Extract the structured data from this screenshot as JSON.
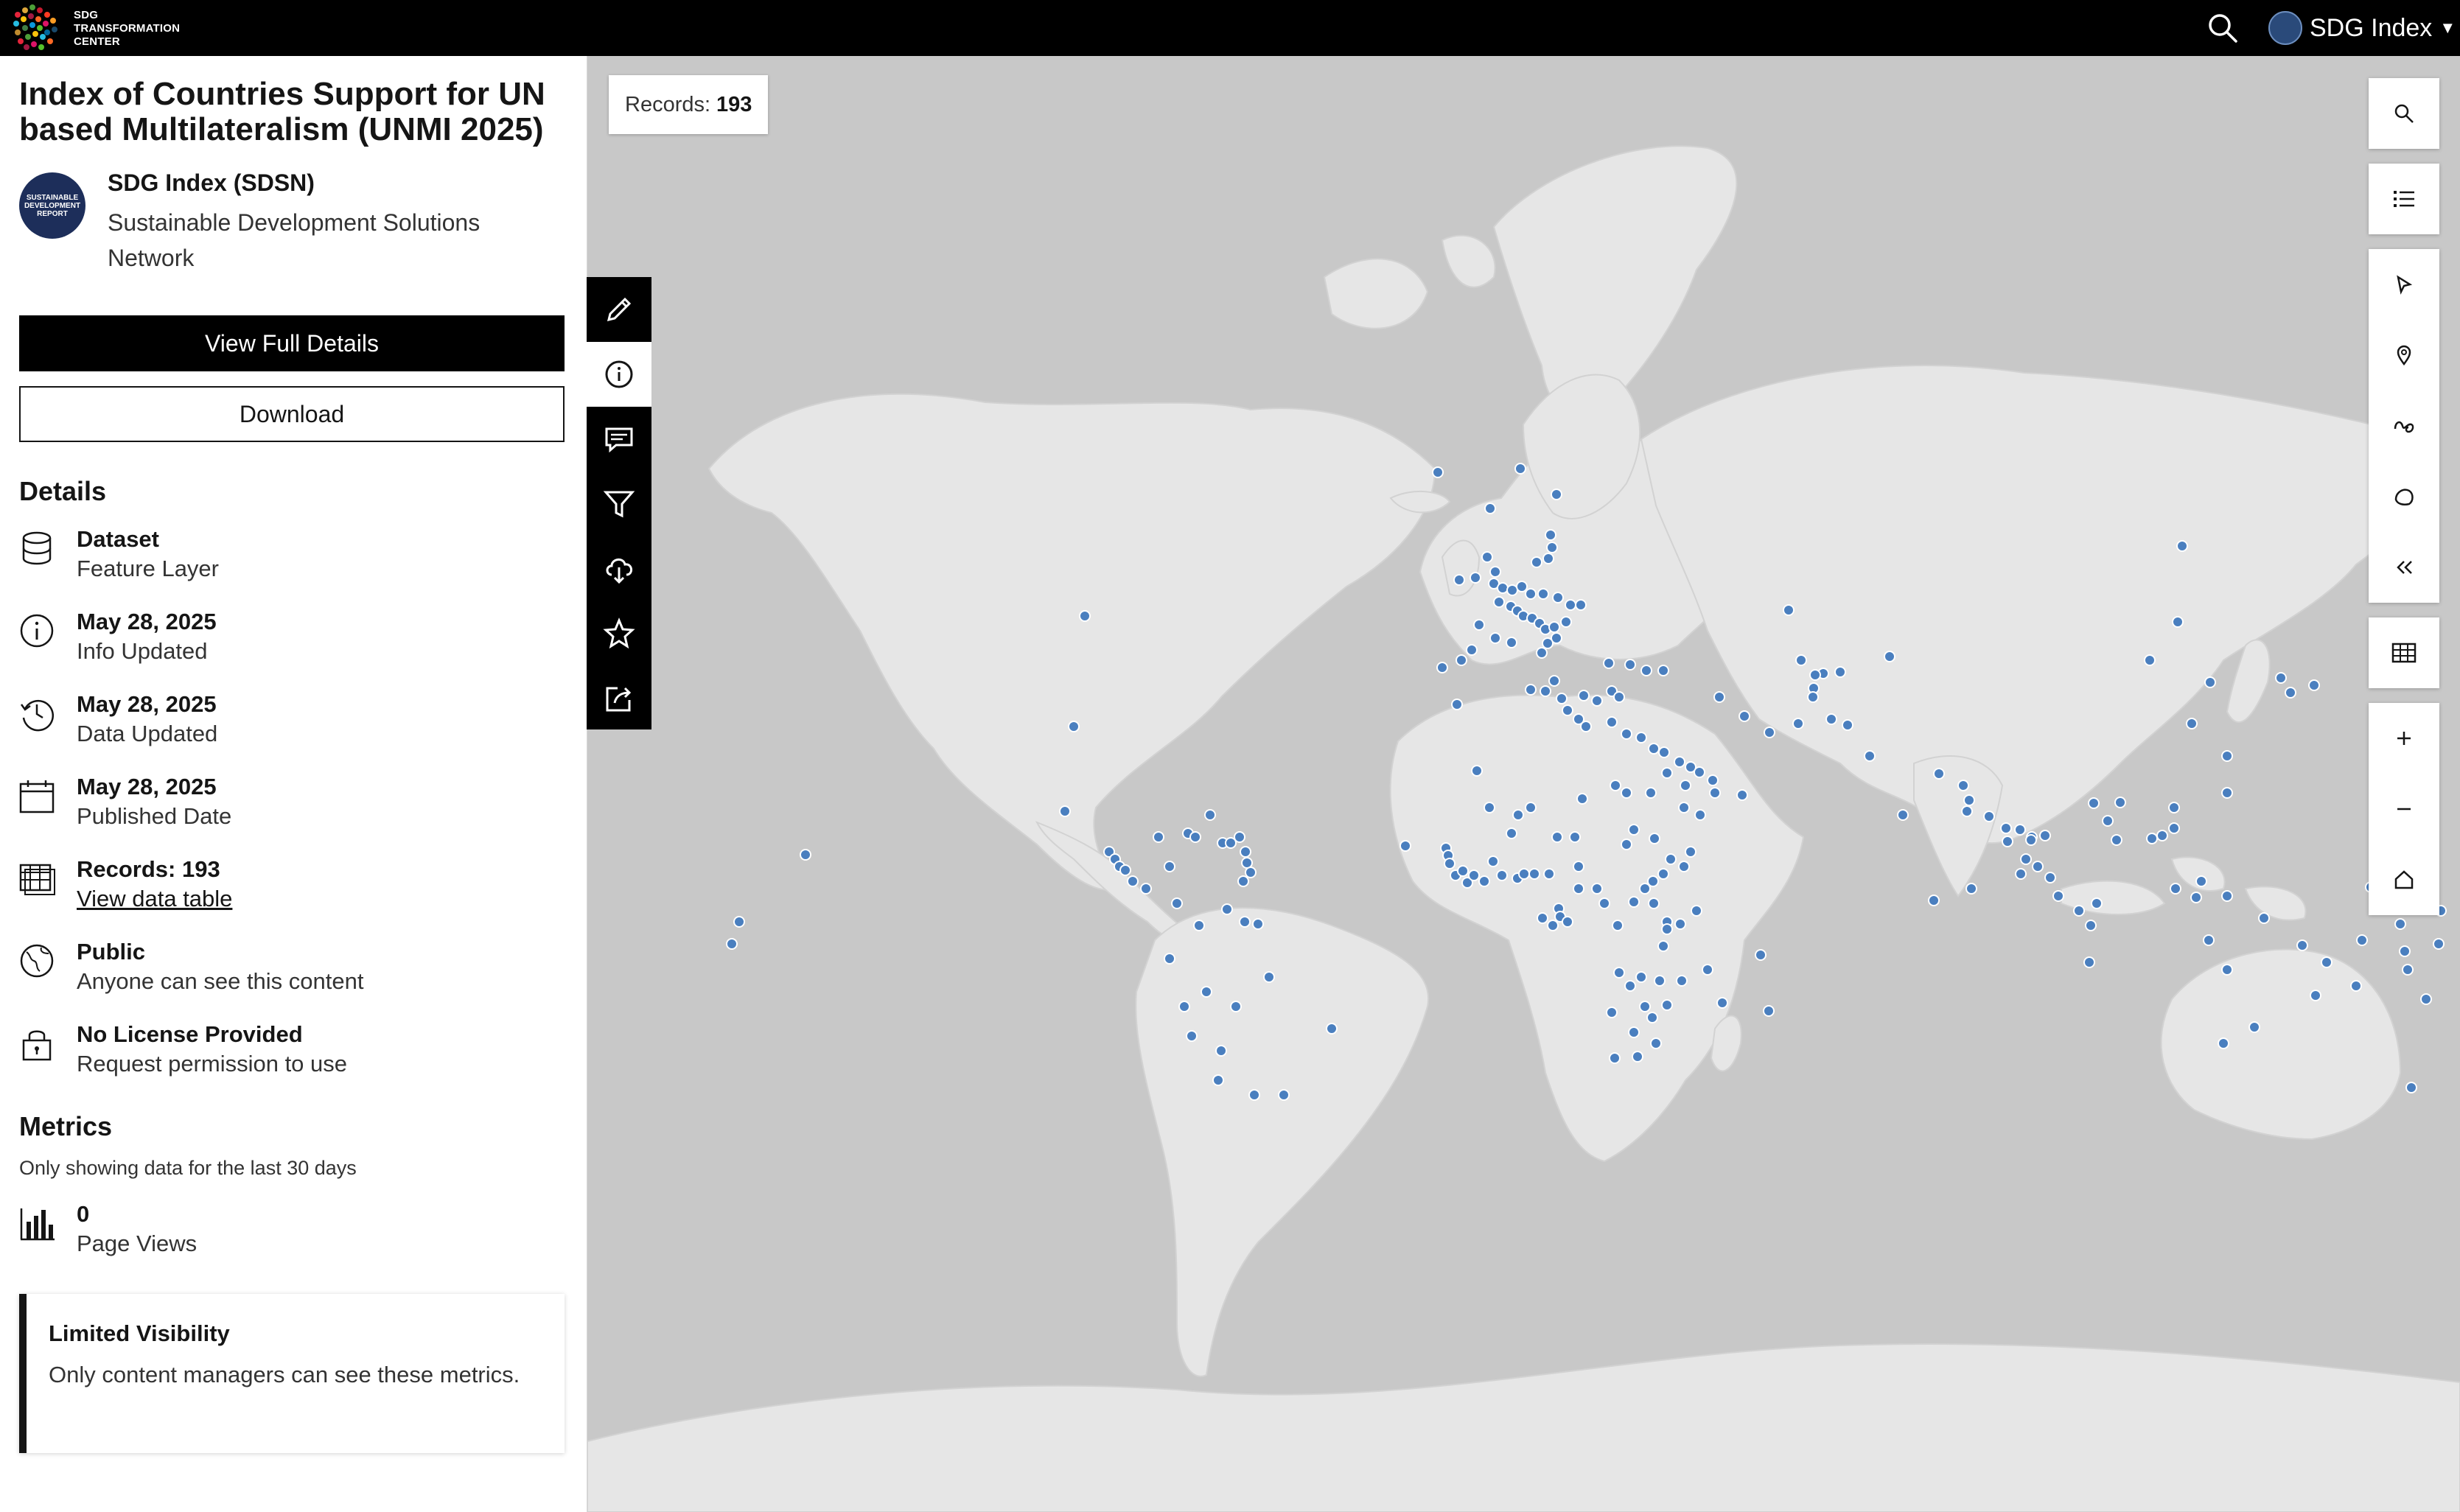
{
  "header": {
    "logo_text": [
      "SDG",
      "TRANSFORMATION",
      "CENTER"
    ],
    "user_label": "SDG Index",
    "icons": {
      "search": "search-icon",
      "caret": "chevron-down-icon"
    }
  },
  "panel": {
    "title": "Index of Countries Support for UN based Multilateralism (UNMI 2025)",
    "owner": {
      "logo_text": "SUSTAINABLE DEVELOPMENT REPORT",
      "name": "SDG Index (SDSN)",
      "org": "Sustainable Development Solutions Network"
    },
    "buttons": {
      "view_details": "View Full Details",
      "download": "Download"
    },
    "details_heading": "Details",
    "details": [
      {
        "icon": "database-icon",
        "title": "Dataset",
        "sub": "Feature Layer"
      },
      {
        "icon": "info-icon",
        "title": "May 28, 2025",
        "sub": "Info Updated"
      },
      {
        "icon": "history-icon",
        "title": "May 28, 2025",
        "sub": "Data Updated"
      },
      {
        "icon": "calendar-icon",
        "title": "May 28, 2025",
        "sub": "Published Date"
      },
      {
        "icon": "table-icon",
        "title": "Records: 193",
        "sub": "View data table"
      },
      {
        "icon": "globe-icon",
        "title": "Public",
        "sub": "Anyone can see this content"
      },
      {
        "icon": "lock-icon",
        "title": "No License Provided",
        "sub": "Request permission to use"
      }
    ],
    "metrics_heading": "Metrics",
    "metrics_sub": "Only showing data for the last 30 days",
    "page_views": {
      "value": "0",
      "label": "Page Views"
    },
    "notice": {
      "title": "Limited Visibility",
      "body": "Only content managers can see these metrics."
    }
  },
  "map": {
    "records_label": "Records:",
    "records_value": "193",
    "point_color": "#4a7fbf",
    "left_tools": [
      "edit-icon",
      "info-icon",
      "comment-icon",
      "filter-icon",
      "cloud-download-icon",
      "star-icon",
      "share-icon"
    ],
    "right_tools": [
      "search-icon",
      "list-icon",
      "select-icon",
      "pin-icon",
      "lasso-icon",
      "polygon-icon",
      "collapse-icon",
      "table-icon",
      "zoom-in-icon",
      "zoom-out-icon",
      "home-icon"
    ]
  }
}
